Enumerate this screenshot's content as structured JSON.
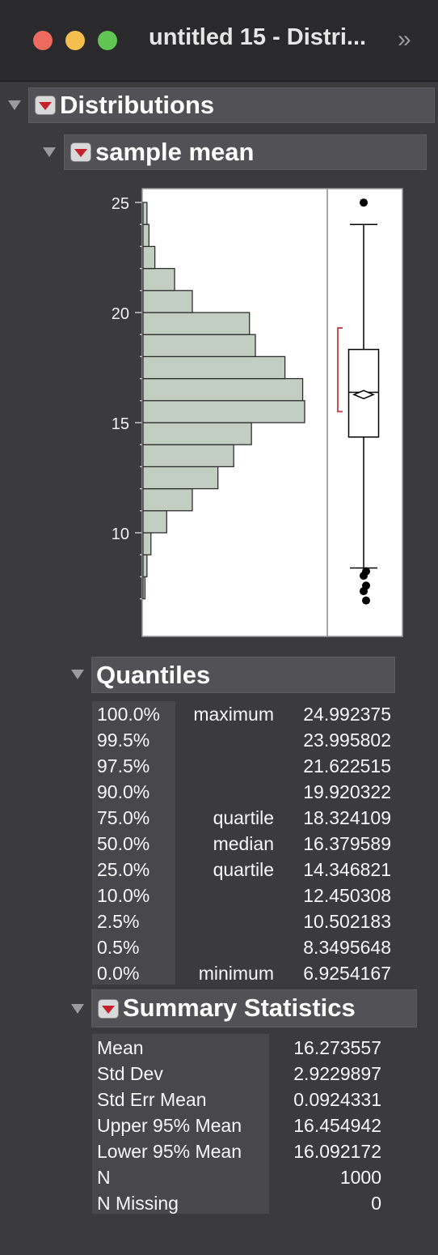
{
  "window": {
    "title": "untitled 15 - Distri...",
    "overflow_icon": "chevron-double-right-icon"
  },
  "distributions": {
    "title": "Distributions"
  },
  "variable": {
    "title": "sample mean"
  },
  "chart_data": {
    "type": "bar",
    "orientation": "horizontal",
    "description_kind": "histogram with box plot",
    "y_ticks": [
      "25",
      "20",
      "15",
      "10"
    ],
    "ylim": [
      6.5,
      25.6
    ],
    "bins": [
      {
        "from": 7,
        "to": 8,
        "count": 1
      },
      {
        "from": 8,
        "to": 9,
        "count": 2
      },
      {
        "from": 9,
        "to": 10,
        "count": 4
      },
      {
        "from": 10,
        "to": 11,
        "count": 12
      },
      {
        "from": 11,
        "to": 12,
        "count": 25
      },
      {
        "from": 12,
        "to": 13,
        "count": 38
      },
      {
        "from": 13,
        "to": 14,
        "count": 46
      },
      {
        "from": 14,
        "to": 15,
        "count": 55
      },
      {
        "from": 15,
        "to": 16,
        "count": 82
      },
      {
        "from": 16,
        "to": 17,
        "count": 81
      },
      {
        "from": 17,
        "to": 18,
        "count": 72
      },
      {
        "from": 18,
        "to": 19,
        "count": 57
      },
      {
        "from": 19,
        "to": 20,
        "count": 54
      },
      {
        "from": 20,
        "to": 21,
        "count": 25
      },
      {
        "from": 21,
        "to": 22,
        "count": 16
      },
      {
        "from": 22,
        "to": 23,
        "count": 6
      },
      {
        "from": 23,
        "to": 24,
        "count": 3
      },
      {
        "from": 24,
        "to": 25,
        "count": 2
      }
    ],
    "max_count": 82,
    "boxplot": {
      "whisker_low": 8.4,
      "q1": 14.346821,
      "median": 16.379589,
      "q3": 18.324109,
      "whisker_high": 24.0,
      "mean": 16.273557,
      "outliers_high": [
        24.992375
      ],
      "outliers_low": [
        8.25,
        8.05,
        7.6,
        7.35,
        6.9254167
      ],
      "shortest_half": [
        15.5,
        19.3
      ]
    },
    "colors": {
      "bar_fill": "#c3cec3",
      "bar_stroke": "#2f2f2f",
      "bracket": "#d03a3a"
    }
  },
  "quantiles": {
    "title": "Quantiles",
    "rows": [
      {
        "pct": "100.0%",
        "label": "maximum",
        "value": "24.992375"
      },
      {
        "pct": "99.5%",
        "label": "",
        "value": "23.995802"
      },
      {
        "pct": "97.5%",
        "label": "",
        "value": "21.622515"
      },
      {
        "pct": "90.0%",
        "label": "",
        "value": "19.920322"
      },
      {
        "pct": "75.0%",
        "label": "quartile",
        "value": "18.324109"
      },
      {
        "pct": "50.0%",
        "label": "median",
        "value": "16.379589"
      },
      {
        "pct": "25.0%",
        "label": "quartile",
        "value": "14.346821"
      },
      {
        "pct": "10.0%",
        "label": "",
        "value": "12.450308"
      },
      {
        "pct": "2.5%",
        "label": "",
        "value": "10.502183"
      },
      {
        "pct": "0.5%",
        "label": "",
        "value": "8.3495648"
      },
      {
        "pct": "0.0%",
        "label": "minimum",
        "value": "6.9254167"
      }
    ]
  },
  "summary": {
    "title": "Summary Statistics",
    "rows": [
      {
        "label": "Mean",
        "value": "16.273557"
      },
      {
        "label": "Std Dev",
        "value": "2.9229897"
      },
      {
        "label": "Std Err Mean",
        "value": "0.0924331"
      },
      {
        "label": "Upper 95% Mean",
        "value": "16.454942"
      },
      {
        "label": "Lower 95% Mean",
        "value": "16.092172"
      },
      {
        "label": "N",
        "value": "1000"
      },
      {
        "label": "N Missing",
        "value": "0"
      }
    ]
  }
}
